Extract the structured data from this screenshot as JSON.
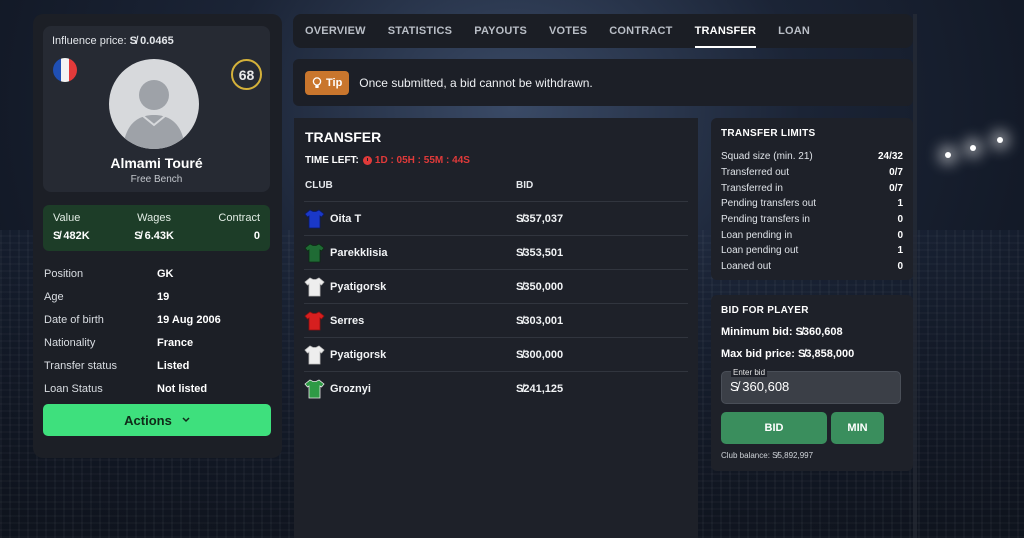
{
  "player": {
    "influence_label": "Influence price:",
    "influence_value": "S̸ 0.0465",
    "rating": "68",
    "name": "Almami Touré",
    "role": "Free Bench",
    "nationality_flag": "france-flag"
  },
  "stats": {
    "value_label": "Value",
    "value": "S̸ 482K",
    "wages_label": "Wages",
    "wages": "S̸ 6.43K",
    "contract_label": "Contract",
    "contract": "0"
  },
  "details": [
    {
      "key": "Position",
      "value": "GK"
    },
    {
      "key": "Age",
      "value": "19"
    },
    {
      "key": "Date of birth",
      "value": "19 Aug 2006"
    },
    {
      "key": "Nationality",
      "value": "France"
    },
    {
      "key": "Transfer status",
      "value": "Listed"
    },
    {
      "key": "Loan Status",
      "value": "Not listed"
    }
  ],
  "actions_label": "Actions",
  "tabs": [
    {
      "label": "OVERVIEW"
    },
    {
      "label": "STATISTICS"
    },
    {
      "label": "PAYOUTS"
    },
    {
      "label": "VOTES"
    },
    {
      "label": "CONTRACT"
    },
    {
      "label": "TRANSFER",
      "active": true
    },
    {
      "label": "LOAN"
    }
  ],
  "tip": {
    "badge": "Tip",
    "text": "Once submitted, a bid cannot be withdrawn."
  },
  "transfer": {
    "title": "TRANSFER",
    "time_left_label": "TIME LEFT:",
    "time_left": "1D : 05H : 55M : 44S",
    "col_club": "CLUB",
    "col_bid": "BID",
    "bids": [
      {
        "club": "Oita T",
        "bid": "S̸357,037",
        "shirt": "#1a38c8",
        "trim": "#0b1a66"
      },
      {
        "club": "Parekklisia",
        "bid": "S̸353,501",
        "shirt": "#1f6b34",
        "trim": "#0c2c14"
      },
      {
        "club": "Pyatigorsk",
        "bid": "S̸350,000",
        "shirt": "#eeeeee",
        "trim": "#bdbdbd"
      },
      {
        "club": "Serres",
        "bid": "S̸303,001",
        "shirt": "#d71f1f",
        "trim": "#8e1010"
      },
      {
        "club": "Pyatigorsk",
        "bid": "S̸300,000",
        "shirt": "#eeeeee",
        "trim": "#bdbdbd"
      },
      {
        "club": "Groznyi",
        "bid": "S̸241,125",
        "shirt": "#2e9a45",
        "trim": "#e9e9e9"
      }
    ]
  },
  "limits": {
    "title": "TRANSFER LIMITS",
    "rows": [
      {
        "label": "Squad size (min. 21)",
        "value": "24/32"
      },
      {
        "label": "Transferred out",
        "value": "0/7"
      },
      {
        "label": "Transferred in",
        "value": "0/7"
      },
      {
        "label": "Pending transfers out",
        "value": "1"
      },
      {
        "label": "Pending transfers in",
        "value": "0"
      },
      {
        "label": "Loan pending in",
        "value": "0"
      },
      {
        "label": "Loan pending out",
        "value": "1"
      },
      {
        "label": "Loaned out",
        "value": "0"
      }
    ]
  },
  "bid_panel": {
    "title": "BID FOR PLAYER",
    "min_bid": "Minimum bid: S̸360,608",
    "max_bid": "Max bid price: S̸3,858,000",
    "input_label": "Enter bid",
    "input_value": "S̸ 360,608",
    "bid_button": "BID",
    "min_button": "MIN",
    "club_balance": "Club balance: S̸5,892,997"
  },
  "colors": {
    "accent_green": "#3ee07d",
    "timer_red": "#e03a3a",
    "tip_orange": "#c9762d",
    "rating_gold": "#d4b13a"
  }
}
